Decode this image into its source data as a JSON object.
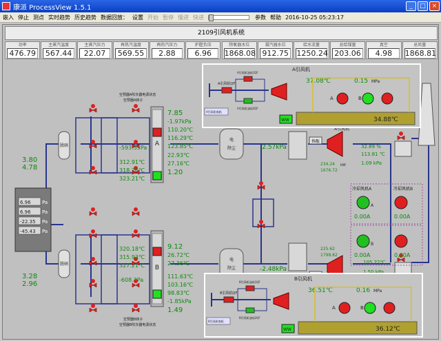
{
  "window": {
    "title": "康派 ProcessView 1.5.1"
  },
  "menu": {
    "items": [
      "嵌入",
      "停止",
      "测点",
      "实时趋势",
      "历史趋势",
      "数据回放：",
      "设置"
    ],
    "disabled_items": [
      "开始",
      "暂停",
      "慢进",
      "快进"
    ],
    "right_items": [
      "参数",
      "帮助"
    ],
    "datetime": "2016-10-25 05:23:17"
  },
  "system_title": "2109引风机系统",
  "header_cells": [
    {
      "label": "功率",
      "value": "476.79"
    },
    {
      "label": "主蒸汽温度",
      "value": "567.44"
    },
    {
      "label": "主蒸汽压力",
      "value": "22.07"
    },
    {
      "label": "再热汽温度",
      "value": "569.55"
    },
    {
      "label": "再热汽压力",
      "value": "2.88"
    },
    {
      "label": "炉膛负压",
      "value": "6.96"
    },
    {
      "label": "除氧器水位",
      "value": "1868.08"
    },
    {
      "label": "凝汽器水位",
      "value": "912.75"
    },
    {
      "label": "给水流量",
      "value": "1250.24"
    },
    {
      "label": "总给煤量",
      "value": "203.06"
    },
    {
      "label": "真空",
      "value": "4.98"
    },
    {
      "label": "总风量",
      "value": "1868.81"
    }
  ],
  "left": {
    "top_vals": [
      "3.80",
      "4.78"
    ],
    "bottom_vals": [
      "3.28",
      "2.96"
    ],
    "furnace": [
      {
        "value": "6.96",
        "unit": "Pa"
      },
      {
        "value": "6.96",
        "unit": "Pa"
      },
      {
        "value": "-22.35",
        "unit": "Pa"
      },
      {
        "value": "-45.43",
        "unit": "Pa"
      }
    ],
    "denox_top": "脱硝",
    "denox_bottom": "脱硝"
  },
  "airheater_a": {
    "label_top": "空预器A吹灰器电源状态",
    "label_2": "空预器A转子",
    "left_vals": [
      "-593.55",
      "312.91",
      "318.76",
      "323.21"
    ],
    "left_unit_first": "Pa",
    "right_vals": [
      "7.85",
      "-1.97",
      "110.20",
      "116.29",
      "123.85",
      "22.93",
      "27.16",
      "1.20"
    ],
    "letter": "A"
  },
  "airheater_b": {
    "label_bottom": "空预器B转子",
    "label_bottom2": "空预器B吹灰器电源状态",
    "left_vals": [
      "320.18",
      "315.93",
      "327.21",
      "-608.2"
    ],
    "right_vals": [
      "9.12",
      "26.72",
      "27.36",
      "111.63",
      "103.16",
      "98.83",
      "-1.85",
      "1.49"
    ],
    "letter": "B"
  },
  "esp": {
    "label_a": "电除尘",
    "label_b": "电除尘",
    "val_a": "-2.57",
    "val_b": "-2.48",
    "unit": "kPa"
  },
  "fan_a": {
    "title": "A引风机",
    "damper": "挡板",
    "vals": [
      "234.24",
      "1676.72"
    ],
    "unit": "kW",
    "right": [
      "32.89",
      "113.81",
      "1.09"
    ],
    "right_units": [
      "%",
      "℃",
      "kPa"
    ]
  },
  "fan_b": {
    "title": "B引风机",
    "damper": "挡板",
    "vals": [
      "225.62",
      "1798.82"
    ],
    "unit": "kW",
    "right": [
      "105.72",
      "1.50",
      "33.56"
    ],
    "right_units": [
      "℃",
      "kPa",
      "%"
    ]
  },
  "cooling": {
    "a_label": "冷却风机A",
    "b_label": "冷却风机B",
    "a_vals": [
      "0.00",
      "0.00"
    ],
    "b_vals": [
      "0.00",
      "0.00"
    ],
    "unit": "A"
  },
  "panel_a": {
    "title": "A引风机",
    "qf": "A引风机QF",
    "lube": "润滑油站",
    "temp1": "37.08℃",
    "pressure": "0.15",
    "pressure_unit": "MPa",
    "oil_temp": "34.88℃",
    "pump_a": "A",
    "pump_b": "B",
    "ww": "WW",
    "motor_label": "A引风机电机",
    "qf1": "A引风机油站1QF",
    "qf2": "A引风机油站2QF"
  },
  "panel_b": {
    "title": "B引风机",
    "qf": "B引风机QF",
    "lube": "润滑油站",
    "temp1": "36.51℃",
    "pressure": "0.16",
    "pressure_unit": "MPa",
    "oil_temp": "36.12℃",
    "pump_a": "A",
    "pump_b": "B",
    "ww": "WW",
    "motor_label": "B引风机电机",
    "qf1": "B引风机油站1QF",
    "qf2": "B引风机油站2QF"
  },
  "colors": {
    "value_green": "#0a8a0a",
    "value_dark": "#1a5a1a",
    "alarm_red": "#e02020",
    "pipe_blue": "#28348c",
    "pipe_yellow": "#d8c020"
  }
}
